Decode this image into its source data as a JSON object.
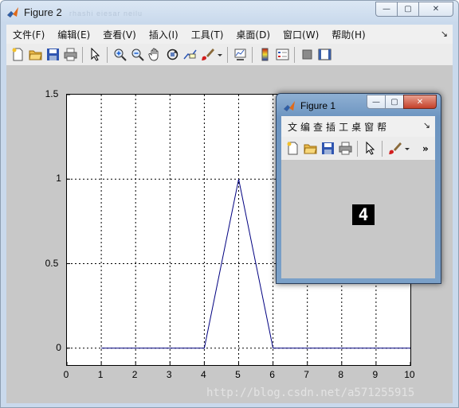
{
  "figure2": {
    "title": "Figure 2",
    "title_ghost": "rhashi eiesar neilu",
    "menu": [
      "文件(F)",
      "编辑(E)",
      "查看(V)",
      "插入(I)",
      "工具(T)",
      "桌面(D)",
      "窗口(W)",
      "帮助(H)"
    ],
    "menu_overflow": "↘"
  },
  "figure1": {
    "title": "Figure 1",
    "menu": [
      "文",
      "编",
      "查",
      "插",
      "工",
      "桌",
      "窗",
      "帮"
    ],
    "menu_overflow": "↘",
    "toolbar_overflow": "»",
    "content_text": "4"
  },
  "caption_buttons": {
    "minimize": "—",
    "maximize": "▢",
    "close": "✕"
  },
  "icons": {
    "toolbar_fig2": [
      "new-file-icon",
      "open-folder-icon",
      "save-icon",
      "print-icon",
      "pointer-icon",
      "zoom-in-icon",
      "zoom-out-icon",
      "pan-hand-icon",
      "rotate-3d-icon",
      "data-cursor-icon",
      "brush-icon",
      "dropdown-arrow-icon",
      "link-plot-icon",
      "colorbar-icon",
      "legend-icon",
      "hide-plot-tools-icon",
      "show-plot-tools-icon"
    ],
    "toolbar_fig1": [
      "new-file-icon",
      "open-folder-icon",
      "save-icon",
      "print-icon",
      "pointer-icon",
      "brush-icon",
      "dropdown-arrow-icon"
    ]
  },
  "chart_data": {
    "type": "line",
    "x": [
      0,
      1,
      2,
      3,
      4,
      5,
      6,
      7,
      8,
      9,
      10
    ],
    "series": [
      {
        "values": [
          null,
          0,
          0,
          0,
          0,
          1,
          0,
          0,
          0,
          0,
          0
        ],
        "color": "#000080"
      }
    ],
    "xlim": [
      0,
      10
    ],
    "ylim": [
      -0.1,
      1.5
    ],
    "xticks": [
      "0",
      "1",
      "2",
      "3",
      "4",
      "5",
      "6",
      "7",
      "8",
      "9",
      "10"
    ],
    "yticks": [
      {
        "value": 0,
        "label": "0"
      },
      {
        "value": 0.5,
        "label": "0.5"
      },
      {
        "value": 1,
        "label": "1"
      },
      {
        "value": 1.5,
        "label": "1.5"
      }
    ],
    "grid": "dotted",
    "title": "",
    "xlabel": "",
    "ylabel": ""
  },
  "watermark": "http://blog.csdn.net/a571255915"
}
